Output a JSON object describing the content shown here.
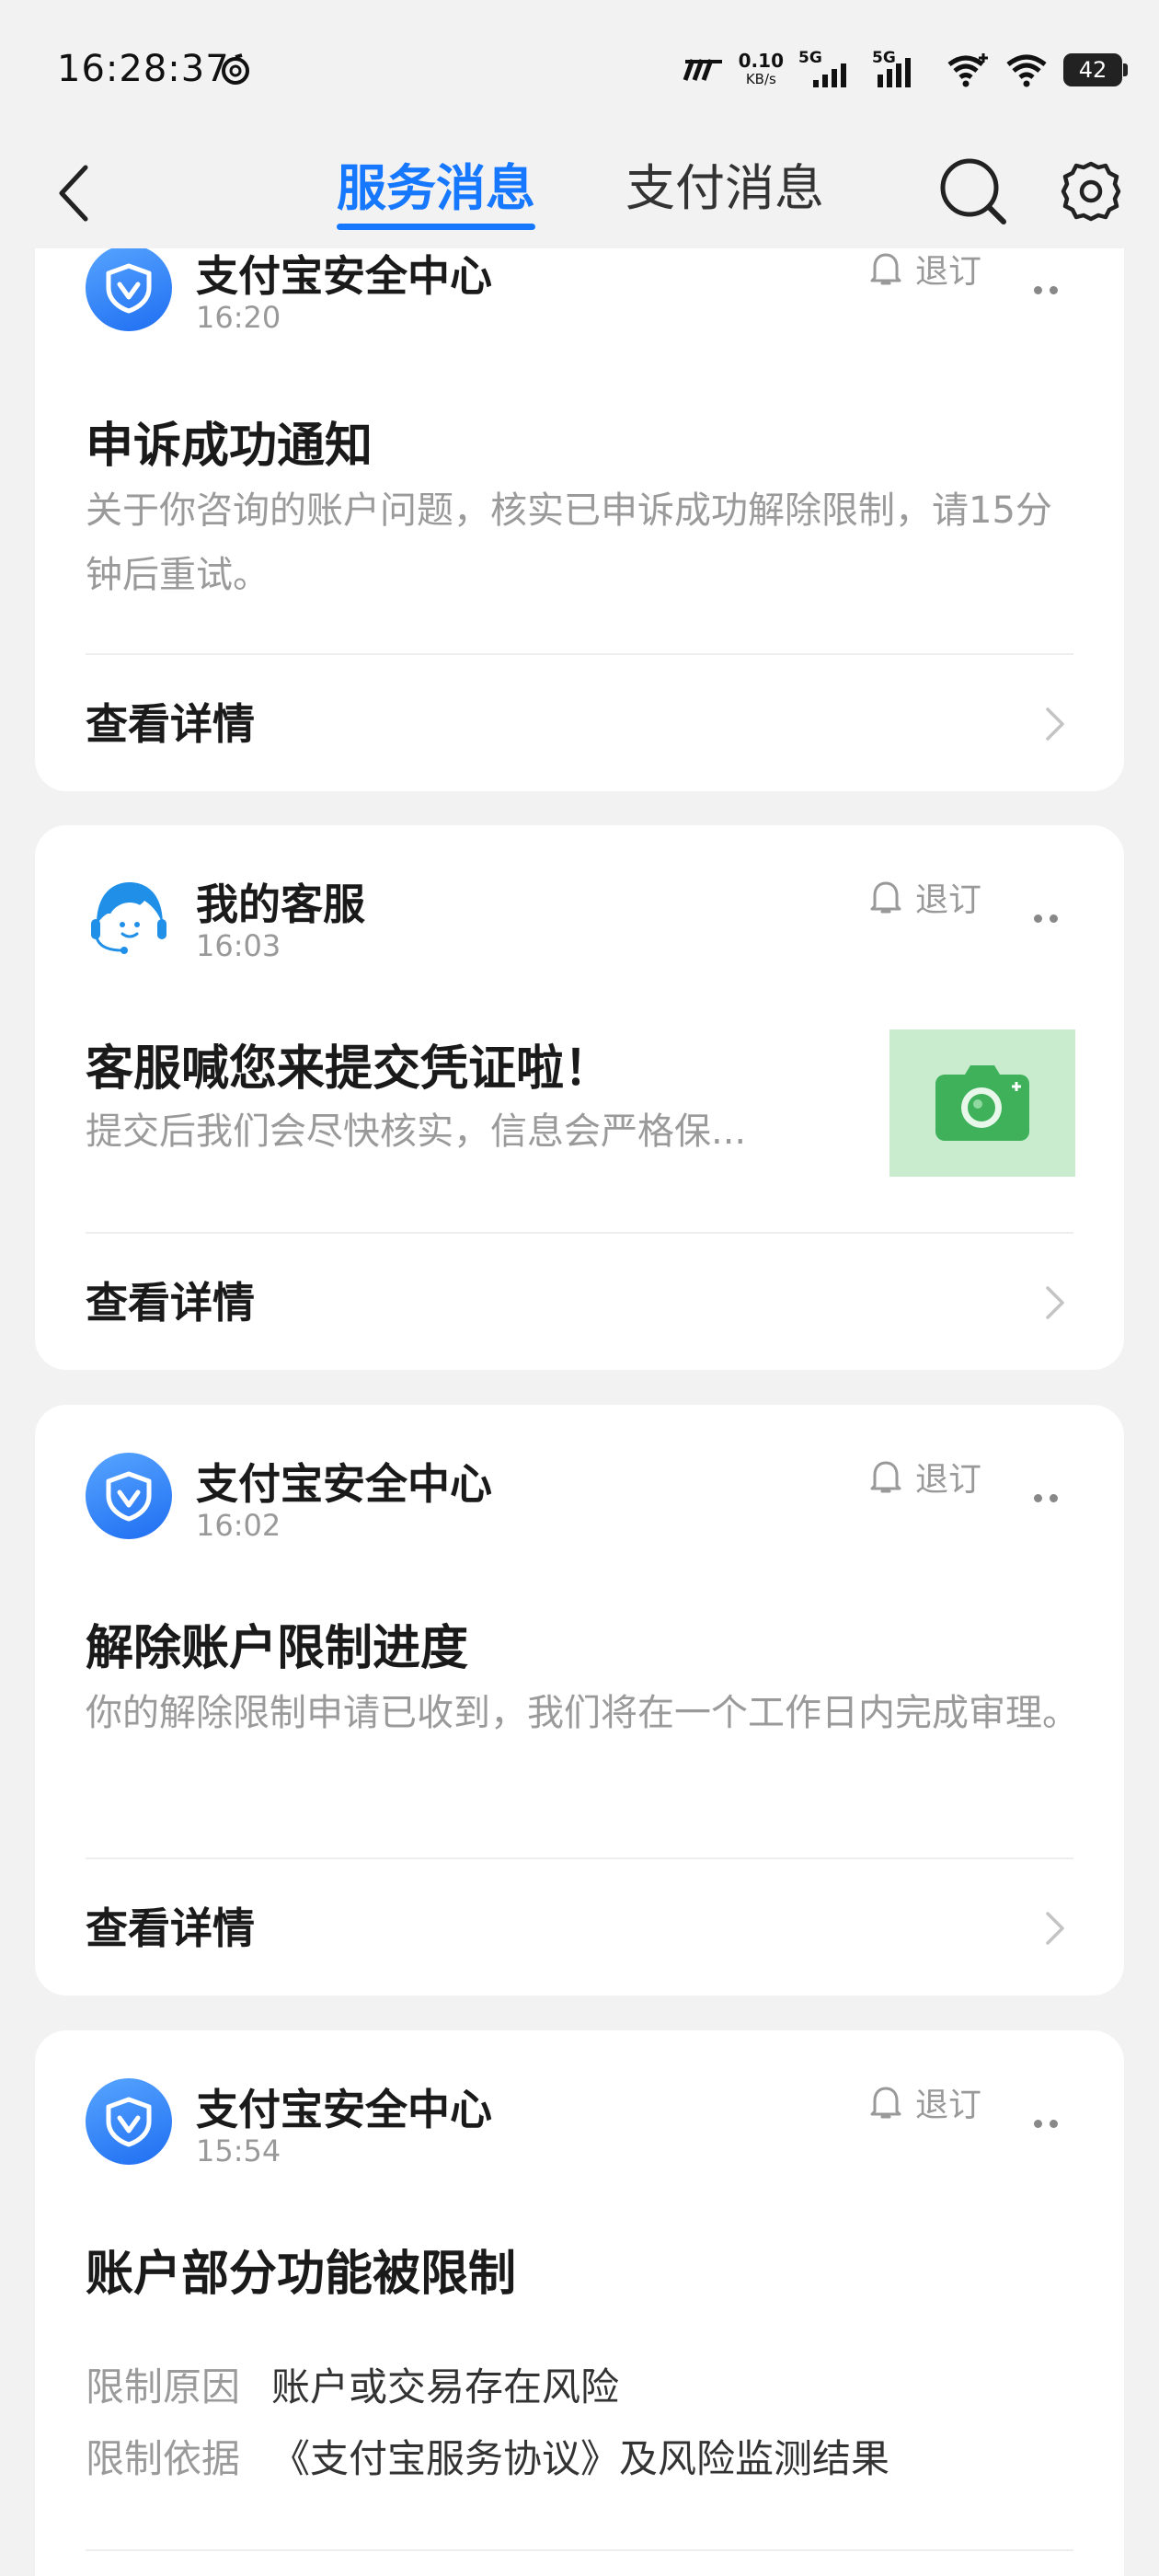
{
  "status_bar": {
    "time": "16:28:37",
    "net_speed_value": "0.10",
    "net_speed_unit": "KB/s",
    "sim1_label": "5G",
    "sim2_label": "5G",
    "battery": "42"
  },
  "header": {
    "tabs": [
      {
        "label": "服务消息",
        "active": true
      },
      {
        "label": "支付消息",
        "active": false
      }
    ]
  },
  "messages": [
    {
      "sender": "支付宝安全中心",
      "time": "16:20",
      "unsubscribe": "退订",
      "title": "申诉成功通知",
      "body": "关于你咨询的账户问题，核实已申诉成功解除限制，请15分钟后重试。",
      "detail": "查看详情"
    },
    {
      "sender": "我的客服",
      "time": "16:03",
      "unsubscribe": "退订",
      "title": "客服喊您来提交凭证啦！",
      "body": "提交后我们会尽快核实，信息会严格保...",
      "detail": "查看详情"
    },
    {
      "sender": "支付宝安全中心",
      "time": "16:02",
      "unsubscribe": "退订",
      "title": "解除账户限制进度",
      "body": "你的解除限制申请已收到，我们将在一个工作日内完成审理。",
      "detail": "查看详情"
    },
    {
      "sender": "支付宝安全中心",
      "time": "15:54",
      "unsubscribe": "退订",
      "title": "账户部分功能被限制",
      "fields": [
        {
          "key": "限制原因",
          "value": "账户或交易存在风险"
        },
        {
          "key": "限制依据",
          "value": "《支付宝服务协议》及风险监测结果"
        }
      ]
    }
  ],
  "colors": {
    "accent": "#1677ff",
    "background": "#f2f2f2",
    "card": "#ffffff",
    "secondary_text": "#999999",
    "thumb_bg": "#c9eccf",
    "camera_green": "#3fb15a"
  }
}
